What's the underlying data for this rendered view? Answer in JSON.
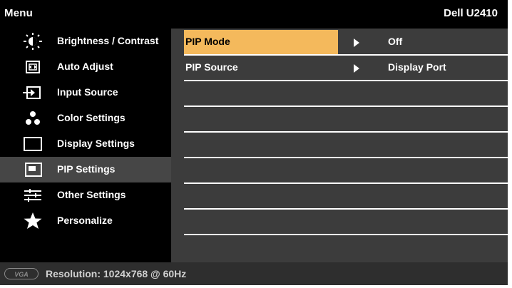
{
  "header": {
    "title": "Menu",
    "model": "Dell U2410"
  },
  "sidebar": {
    "selected_index": 5,
    "items": [
      {
        "label": "Brightness / Contrast",
        "icon": "brightness-icon"
      },
      {
        "label": "Auto Adjust",
        "icon": "auto-adjust-icon"
      },
      {
        "label": "Input Source",
        "icon": "input-source-icon"
      },
      {
        "label": "Color Settings",
        "icon": "color-settings-icon"
      },
      {
        "label": "Display Settings",
        "icon": "display-settings-icon"
      },
      {
        "label": "PIP Settings",
        "icon": "pip-settings-icon"
      },
      {
        "label": "Other Settings",
        "icon": "other-settings-icon"
      },
      {
        "label": "Personalize",
        "icon": "personalize-icon"
      }
    ]
  },
  "submenu": {
    "rows": [
      {
        "label": "PIP Mode",
        "value": "Off",
        "selected": true
      },
      {
        "label": "PIP Source",
        "value": "Display Port",
        "selected": false
      }
    ]
  },
  "footer": {
    "connector_badge": "VGA",
    "resolution": "Resolution: 1024x768 @ 60Hz"
  },
  "colors": {
    "background": "#000000",
    "sidebar_selected": "#464646",
    "panel": "#3c3c3c",
    "highlight": "#f4b95c",
    "footer": "#2e2e2e"
  }
}
